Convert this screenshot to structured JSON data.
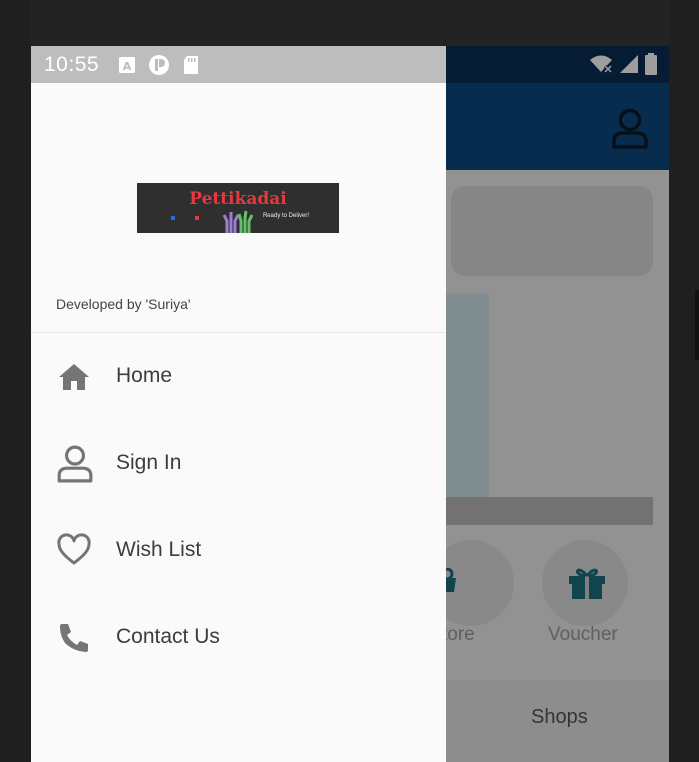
{
  "status_bar": {
    "time": "10:55",
    "icons": [
      "a-icon",
      "pen-circle-icon",
      "sd-card-icon"
    ],
    "right_icons": [
      "wifi-off-icon",
      "signal-icon",
      "battery-icon"
    ]
  },
  "drawer": {
    "logo": {
      "title": "Pettikadai",
      "tagline": "Ready to Deliver!"
    },
    "credit": "Developed by 'Suriya'",
    "menu": [
      {
        "label": "Home",
        "icon": "home-icon"
      },
      {
        "label": "Sign In",
        "icon": "person-icon"
      },
      {
        "label": "Wish List",
        "icon": "heart-icon"
      },
      {
        "label": "Contact Us",
        "icon": "phone-icon"
      }
    ]
  },
  "background_app": {
    "categories": [
      {
        "label": "tore",
        "icon": "store-icon"
      },
      {
        "label": "Voucher",
        "icon": "gift-icon"
      }
    ],
    "bottom_tab": "Shops"
  },
  "colors": {
    "app_bar": "#0e487e",
    "drawer_bg": "#fafafa",
    "logo_red": "#e6393f"
  }
}
